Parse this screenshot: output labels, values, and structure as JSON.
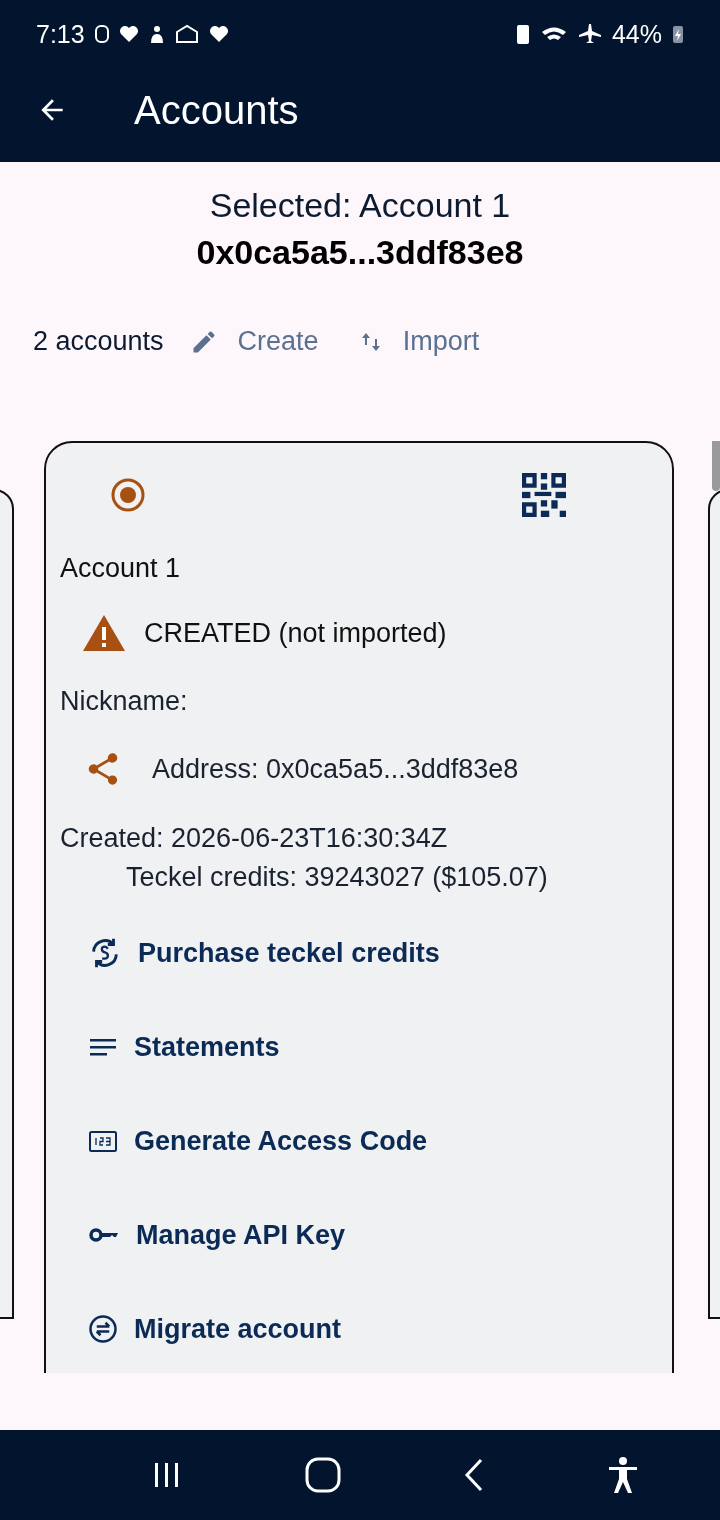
{
  "status_bar": {
    "time": "7:13",
    "battery": "44%"
  },
  "app_bar": {
    "title": "Accounts"
  },
  "selection": {
    "label": "Selected: Account 1",
    "address": "0x0ca5a5...3ddf83e8"
  },
  "toolbar": {
    "count": "2 accounts",
    "actions": [
      {
        "kind": "create",
        "label": "Create"
      },
      {
        "kind": "import",
        "label": "Import"
      }
    ]
  },
  "card": {
    "selected": true,
    "name": "Account 1",
    "status": "CREATED (not imported)",
    "nickname": "Nickname:",
    "address": "Address: 0x0ca5a5...3ddf83e8",
    "created": "Created: 2026-06-23T16:30:34Z",
    "credits": "Teckel credits: 39243027 ($105.07)",
    "actions": [
      {
        "kind": "purchase",
        "label": "Purchase teckel credits"
      },
      {
        "kind": "statements",
        "label": "Statements"
      },
      {
        "kind": "access_code",
        "label": "Generate Access Code"
      },
      {
        "kind": "api_key",
        "label": "Manage API Key"
      },
      {
        "kind": "migrate",
        "label": "Migrate account"
      }
    ]
  }
}
